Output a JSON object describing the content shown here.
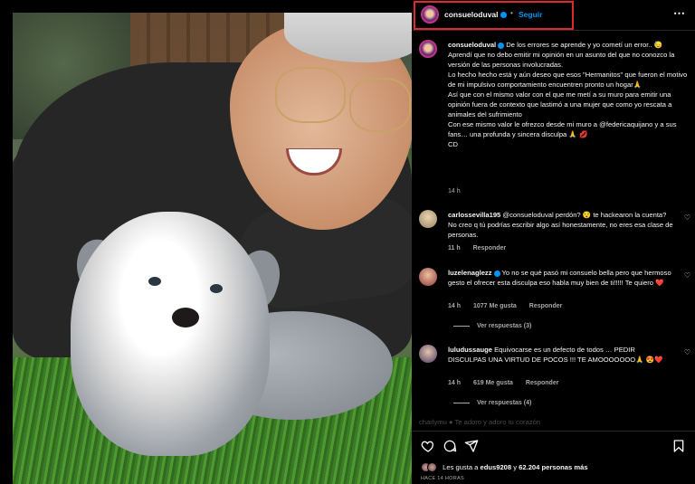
{
  "post": {
    "username": "consueloduval",
    "dot": "•",
    "follow_label": "Seguir",
    "more_icon": "⋯"
  },
  "caption": {
    "username": "consueloduval",
    "lines": [
      "De los errores se aprende y yo cometí un error.. 😓",
      "Aprendí que no debo emitir mi opinión en un asunto del que no conozco la versión de las personas involucradas.",
      "Lo hecho hecho está y aún deseo que esos \"Hermanitos\" que fueron el motivo de mi impulsivo comportamiento encuentren pronto un hogar🙏",
      "Así que con el mismo valor con el que me metí a su muro para emitir una opinión fuera de contexto que lastimó a una mujer que como yo rescata a animales del sufrimiento",
      "Con ese mismo valor le ofrezco desde mi muro a @federicaquijano y a sus fans… una profunda y sincera disculpa 🙏 💋",
      "CD"
    ],
    "time": "14 h"
  },
  "comments": [
    {
      "username": "carlossevilla195",
      "text": "@consueloduval perdón? 😯 te hackearon la cuenta? No creo q tú podrías escribir algo así honestamente, no eres esa clase de personas.",
      "time": "11 h",
      "likes": "",
      "reply": "Responder",
      "replies": ""
    },
    {
      "username": "luzelenaglezz",
      "text": "Yo no se qué pasó mi consuelo bella pero que hermoso gesto el ofrecer esta disculpa eso habla muy bien de ti!!!!! Te quiero ❤️",
      "time": "14 h",
      "likes": "1077 Me gusta",
      "reply": "Responder",
      "replies": "Ver respuestas (3)"
    },
    {
      "username": "luludussauge",
      "text": "Equivocarse es un defecto de todos … PEDIR DISCULPAS UNA VIRTUD DE POCOS !!! TE AMOOOOOOO🙏 😍❤️",
      "time": "14 h",
      "likes": "619 Me gusta",
      "reply": "Responder",
      "replies": "Ver respuestas (4)"
    }
  ],
  "faded_comment": "charlymu ● Te adoro y adoro tu corazón",
  "likes": {
    "prefix": "Les gusta a ",
    "user": "edus9208",
    "middle": " y ",
    "count": "62.204 personas",
    "suffix": " más"
  },
  "posted_time": "HACE 14 HORAS",
  "icons": {
    "like": "heart-icon",
    "comment": "comment-icon",
    "share": "share-icon",
    "save": "bookmark-icon"
  },
  "colors": {
    "accent": "#0095f6",
    "highlight_border": "#e0282e",
    "like_red": "#ed4956"
  }
}
